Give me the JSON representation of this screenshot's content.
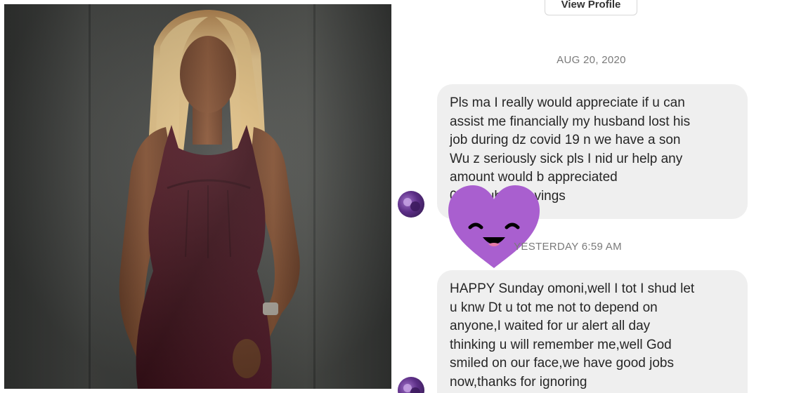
{
  "colors": {
    "bubble_bg": "#efefef",
    "text": "#262626",
    "date_text": "#7a7a7a",
    "sticker_heart": "#a95fcf",
    "photo_background": "#464845",
    "dress": "#4a1620",
    "hair": "#e6c489"
  },
  "chat": {
    "view_profile_label": "View Profile",
    "messages": [
      {
        "date_separator": "AUG 20, 2020",
        "lines": [
          "Pls ma I really would appreciate if u can",
          "assist me financially my husband lost his",
          "job during dz covid 19 n we have a son",
          "Wu z seriously sick pls I nid ur help any",
          "amount would b appreciated",
          "0      390         uba shavings"
        ]
      },
      {
        "date_separator": "YESTERDAY 6:59 AM",
        "lines": [
          "HAPPY Sunday omoni,well I tot I shud let",
          "u knw Dt u tot me not to depend on",
          "anyone,I waited for ur alert all day",
          "thinking u will remember me,well God",
          "smiled on our face,we have good jobs",
          "now,thanks for ignoring"
        ]
      }
    ],
    "sticker_icon": "smiling-purple-heart-icon",
    "avatar_icon": "user-avatar-icon"
  }
}
